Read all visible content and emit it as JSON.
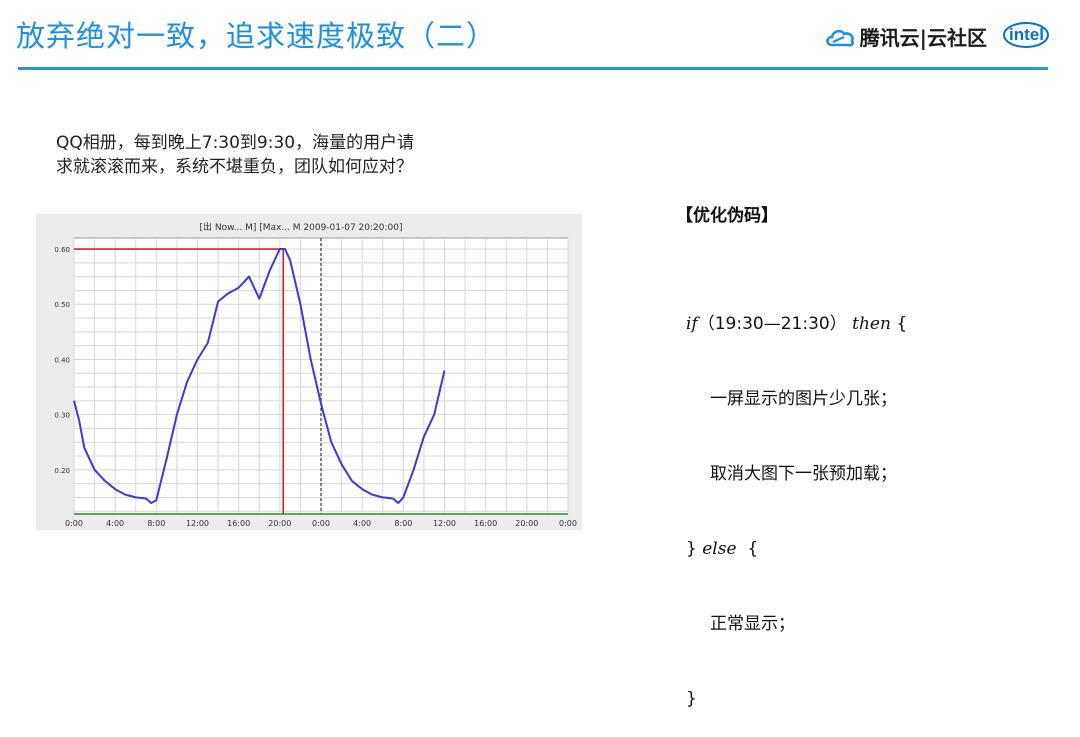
{
  "header": {
    "title": "放弃绝对一致，追求速度极致（二）",
    "brand_name": "腾讯云|云社区",
    "intel_label": "intel"
  },
  "question": {
    "line1": "QQ相册，每到晚上7:30到9:30，海量的用户请",
    "line2": "求就滚滚而来，系统不堪重负，团队如何应对？"
  },
  "pseudocode": {
    "title": "【优化伪码】",
    "if_keyword": "if",
    "condition": "（19:30—21:30）",
    "then_keyword": "then",
    "open_brace": " {",
    "then_line1": "一屏显示的图片少几张；",
    "then_line2": "取消大图下一张预加载；",
    "close_brace_else": "}",
    "else_keyword": "else",
    "else_open": "  {",
    "else_line1": "正常显示；",
    "close_brace": "}"
  },
  "colors": {
    "title_blue": "#1f8fe0",
    "rule_blue": "#2c8fe0",
    "series_blue": "#3a3ad6",
    "marker_red": "#e02020"
  },
  "chart_data": {
    "type": "line",
    "title": "[出 Now... M] [Max... M 2009-01-07 20:20:00]",
    "x_tick_labels": [
      "0:00",
      "4:00",
      "8:00",
      "12:00",
      "16:00",
      "20:00",
      "0:00",
      "4:00",
      "8:00",
      "12:00",
      "16:00",
      "20:00",
      "0:00"
    ],
    "y_tick_labels": [
      "0.20",
      "0.30",
      "0.40",
      "0.50",
      "0.60"
    ],
    "ylim": [
      0.12,
      0.62
    ],
    "xlim": [
      0,
      48
    ],
    "grid": true,
    "peak_time_hours": 20.33,
    "peak_value": 0.6,
    "midnight_marker_hours": 24,
    "series": [
      {
        "values": [
          [
            0,
            0.325
          ],
          [
            0.5,
            0.29
          ],
          [
            1,
            0.24
          ],
          [
            2,
            0.2
          ],
          [
            3,
            0.18
          ],
          [
            4,
            0.165
          ],
          [
            5,
            0.155
          ],
          [
            6,
            0.15
          ],
          [
            7,
            0.148
          ],
          [
            7.5,
            0.14
          ],
          [
            8,
            0.145
          ],
          [
            9,
            0.22
          ],
          [
            10,
            0.3
          ],
          [
            11,
            0.36
          ],
          [
            12,
            0.4
          ],
          [
            13,
            0.43
          ],
          [
            14,
            0.505
          ],
          [
            15,
            0.52
          ],
          [
            16,
            0.53
          ],
          [
            17,
            0.55
          ],
          [
            18,
            0.51
          ],
          [
            19,
            0.56
          ],
          [
            20,
            0.6
          ],
          [
            20.5,
            0.6
          ],
          [
            21,
            0.58
          ],
          [
            22,
            0.5
          ],
          [
            23,
            0.4
          ],
          [
            24,
            0.32
          ],
          [
            25,
            0.25
          ],
          [
            26,
            0.21
          ],
          [
            27,
            0.18
          ],
          [
            28,
            0.165
          ],
          [
            29,
            0.155
          ],
          [
            30,
            0.15
          ],
          [
            31,
            0.148
          ],
          [
            31.5,
            0.14
          ],
          [
            32,
            0.15
          ],
          [
            33,
            0.2
          ],
          [
            34,
            0.26
          ],
          [
            35,
            0.3
          ],
          [
            36,
            0.38
          ]
        ]
      }
    ]
  }
}
